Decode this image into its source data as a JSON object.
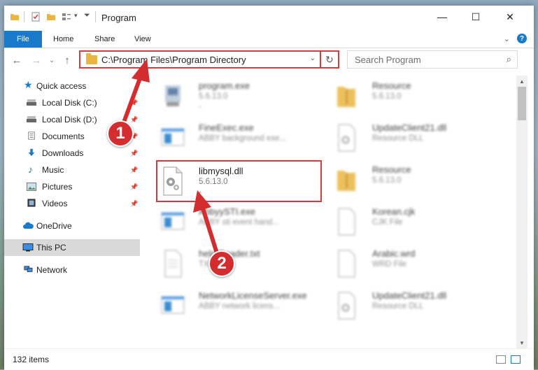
{
  "window": {
    "title": "Program"
  },
  "ribbon": {
    "tabs": [
      "File",
      "Home",
      "Share",
      "View"
    ]
  },
  "nav": {
    "address": "C:\\Program Files\\Program Directory",
    "search_placeholder": "Search Program"
  },
  "sidebar": {
    "items": [
      {
        "label": "Quick access",
        "icon": "star-icon",
        "pinned": false
      },
      {
        "label": "Local Disk (C:)",
        "icon": "drive-icon",
        "pinned": true
      },
      {
        "label": "Local Disk (D:)",
        "icon": "drive-icon",
        "pinned": true
      },
      {
        "label": "Documents",
        "icon": "documents-icon",
        "pinned": true
      },
      {
        "label": "Downloads",
        "icon": "download-icon",
        "pinned": true
      },
      {
        "label": "Music",
        "icon": "music-icon",
        "pinned": true
      },
      {
        "label": "Pictures",
        "icon": "pictures-icon",
        "pinned": true
      },
      {
        "label": "Videos",
        "icon": "video-icon",
        "pinned": true
      },
      {
        "label": "OneDrive",
        "icon": "cloud-icon",
        "pinned": false
      },
      {
        "label": "This PC",
        "icon": "computer-icon",
        "pinned": false
      },
      {
        "label": "Network",
        "icon": "network-icon",
        "pinned": false
      }
    ]
  },
  "files": [
    {
      "name": "program.exe",
      "meta1": "5.6.13.0",
      "meta2": "-",
      "icon": "exe-icon",
      "blurred": true
    },
    {
      "name": "Resource",
      "meta1": "5.6.13.0",
      "meta2": "",
      "icon": "folder-zip-icon",
      "blurred": true
    },
    {
      "name": "FineExec.exe",
      "meta1": "ABBY background exe...",
      "meta2": "",
      "icon": "app-window-icon",
      "blurred": true
    },
    {
      "name": "UpdateClient21.dll",
      "meta1": "Resource DLL",
      "meta2": "",
      "icon": "dll-icon",
      "blurred": true
    },
    {
      "name": "libmysql.dll",
      "meta1": "5.6.13.0",
      "meta2": "-",
      "icon": "dll-gear-icon",
      "blurred": false
    },
    {
      "name": "Resource",
      "meta1": "5.6.13.0",
      "meta2": "",
      "icon": "folder-zip-icon",
      "blurred": true
    },
    {
      "name": "AbbyySTI.exe",
      "meta1": "ABBY sti event hand...",
      "meta2": "",
      "icon": "app-window-icon",
      "blurred": true
    },
    {
      "name": "Korean.cjk",
      "meta1": "CJK File",
      "meta2": "",
      "icon": "blank-file-icon",
      "blurred": true
    },
    {
      "name": "help.Reader.txt",
      "meta1": "TXT File",
      "meta2": "",
      "icon": "text-file-icon",
      "blurred": true
    },
    {
      "name": "Arabic.wrd",
      "meta1": "WRD File",
      "meta2": "",
      "icon": "blank-file-icon",
      "blurred": true
    },
    {
      "name": "NetworkLicenseServer.exe",
      "meta1": "ABBY network licens...",
      "meta2": "",
      "icon": "app-window-icon",
      "blurred": true
    },
    {
      "name": "UpdateClient21.dll",
      "meta1": "Resource DLL",
      "meta2": "",
      "icon": "dll-icon",
      "blurred": true
    }
  ],
  "status": {
    "count": "132 items"
  },
  "callouts": [
    "1",
    "2"
  ],
  "colors": {
    "accent": "#1979ca",
    "highlight": "#d9393a",
    "callout": "#d32d2f",
    "folder": "#e9b640"
  }
}
